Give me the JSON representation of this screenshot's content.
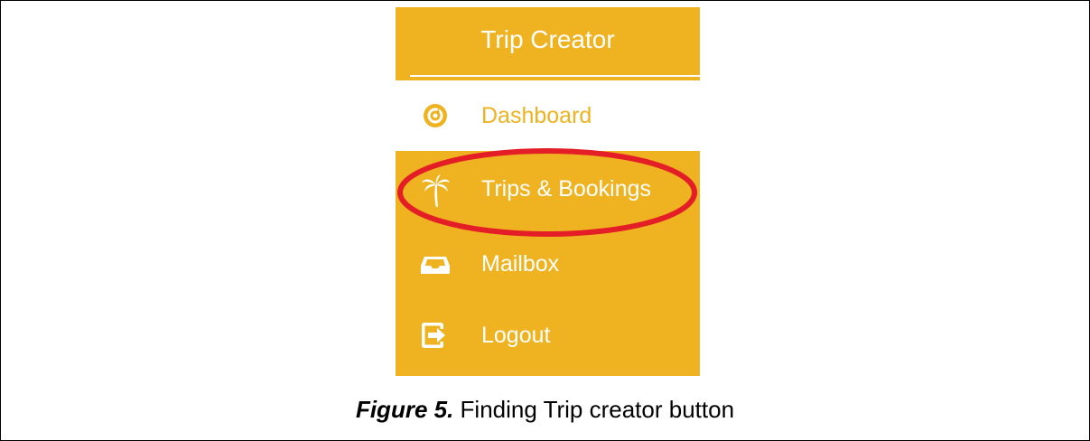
{
  "sidebar": {
    "title": "Trip Creator",
    "items": [
      {
        "label": "Dashboard",
        "icon": "dashboard-icon",
        "active": true
      },
      {
        "label": "Trips & Bookings",
        "icon": "palm-tree-icon",
        "active": false
      },
      {
        "label": "Mailbox",
        "icon": "inbox-icon",
        "active": false
      },
      {
        "label": "Logout",
        "icon": "logout-icon",
        "active": false
      }
    ]
  },
  "caption": {
    "figure": "Figure 5.",
    "text": " Finding Trip creator button"
  },
  "colors": {
    "sidebar_bg": "#EFB321",
    "active_bg": "#FFFFFF",
    "highlight": "#E41E26"
  }
}
